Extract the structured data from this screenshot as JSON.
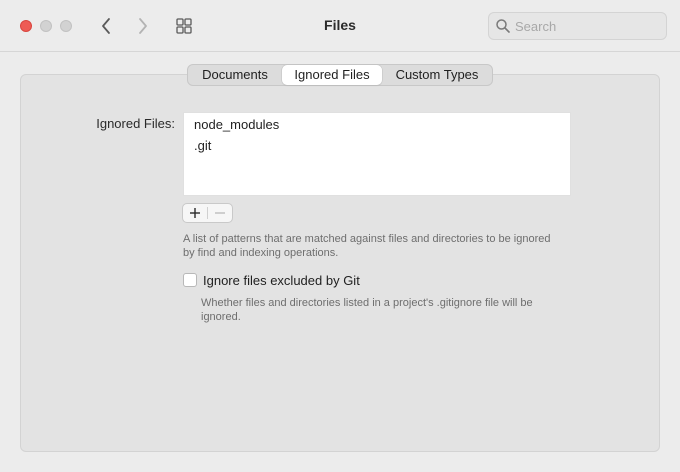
{
  "window": {
    "title": "Files"
  },
  "toolbar": {
    "back_icon": "chevron-left-icon",
    "forward_icon": "chevron-right-icon",
    "grid_icon": "grid-icon"
  },
  "search": {
    "placeholder": "Search",
    "value": ""
  },
  "tabs": [
    {
      "label": "Documents",
      "active": false
    },
    {
      "label": "Ignored Files",
      "active": true
    },
    {
      "label": "Custom Types",
      "active": false
    }
  ],
  "ignored_files": {
    "label": "Ignored Files:",
    "items": [
      "node_modules",
      ".git"
    ],
    "add_icon": "plus-icon",
    "remove_icon": "minus-icon",
    "help": "A list of patterns that are matched against files and directories to be ignored by find and indexing operations."
  },
  "git_option": {
    "label": "Ignore files excluded by Git",
    "checked": false,
    "help": "Whether files and directories listed in a project's .gitignore file will be ignored."
  },
  "colors": {
    "close": "#ee5b54",
    "window_bg": "#ececec",
    "panel_bg": "#e3e3e3",
    "help_text": "#6e6e6e"
  }
}
